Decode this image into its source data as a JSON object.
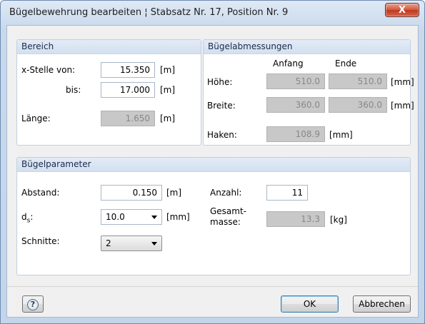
{
  "window": {
    "title": "Bügelbewehrung bearbeiten ¦ Stabsatz Nr. 17, Position Nr. 9",
    "close_glyph": "X"
  },
  "bereich": {
    "header": "Bereich",
    "x_von_label": "x-Stelle von:",
    "x_von_value": "15.350",
    "x_von_unit": "[m]",
    "bis_label": "bis:",
    "bis_value": "17.000",
    "bis_unit": "[m]",
    "laenge_label": "Länge:",
    "laenge_value": "1.650",
    "laenge_unit": "[m]"
  },
  "abmessungen": {
    "header": "Bügelabmessungen",
    "col_anfang": "Anfang",
    "col_ende": "Ende",
    "hoehe_label": "Höhe:",
    "hoehe_anfang": "510.0",
    "hoehe_ende": "510.0",
    "hoehe_unit": "[mm]",
    "breite_label": "Breite:",
    "breite_anfang": "360.0",
    "breite_ende": "360.0",
    "breite_unit": "[mm]",
    "haken_label": "Haken:",
    "haken_value": "108.9",
    "haken_unit": "[mm]"
  },
  "parameter": {
    "header": "Bügelparameter",
    "abstand_label": "Abstand:",
    "abstand_value": "0.150",
    "abstand_unit": "[m]",
    "ds_label": "d",
    "ds_sub": "s",
    "ds_colon": ":",
    "ds_value": "10.0",
    "ds_unit": "[mm]",
    "schnitte_label": "Schnitte:",
    "schnitte_value": "2",
    "anzahl_label": "Anzahl:",
    "anzahl_value": "11",
    "gesamt_label_1": "Gesamt-",
    "gesamt_label_2": "masse:",
    "gesamt_value": "13.3",
    "gesamt_unit": "[kg]"
  },
  "footer": {
    "help_icon": "help-icon",
    "help_glyph": "?",
    "ok_label": "OK",
    "cancel_label": "Abbrechen"
  },
  "colors": {
    "readonly_bg": "#c8c8c8",
    "group_header": "#d3e0f0",
    "close_button": "#c0381f"
  }
}
